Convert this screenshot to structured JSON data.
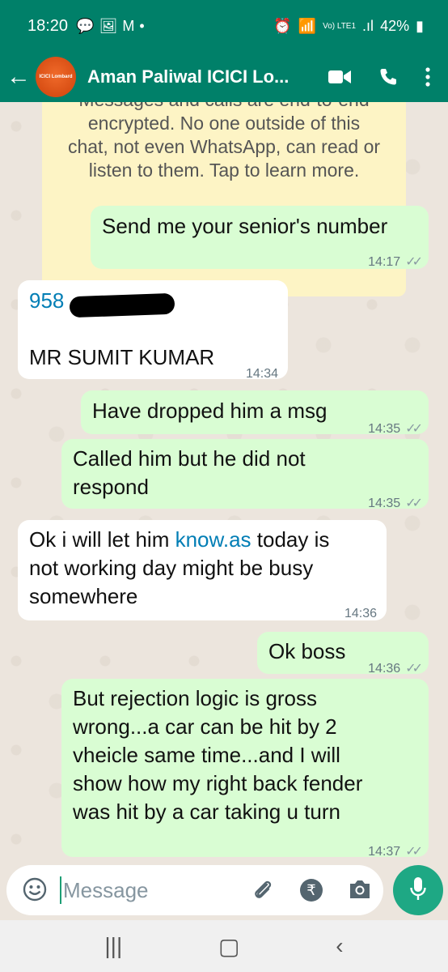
{
  "status_bar": {
    "time": "18:20",
    "battery": "42%",
    "network": "Vo) LTE1"
  },
  "header": {
    "contact_name": "Aman Paliwal ICICI Lo...",
    "avatar_text": "ICICI Lombard"
  },
  "encryption_notice": {
    "lines": [
      "Messages and calls are end-to-end",
      "encrypted. No one outside of this",
      "chat, not even WhatsApp, can read or",
      "listen to them. Tap to learn more."
    ]
  },
  "messages": [
    {
      "direction": "out",
      "text": "Send me your senior's number",
      "time": "14:17"
    },
    {
      "direction": "in",
      "number_prefix": "958",
      "text": "MR SUMIT KUMAR",
      "time": "14:34"
    },
    {
      "direction": "out",
      "text": "Have dropped him a msg",
      "time": "14:35"
    },
    {
      "direction": "out",
      "lines": [
        "Called him but he did not",
        "respond"
      ],
      "time": "14:35"
    },
    {
      "direction": "in",
      "line1_pre": "Ok i will let him ",
      "line1_link": "know.as",
      "line1_post": " today is",
      "lines": [
        "not working day might be busy",
        "somewhere"
      ],
      "time": "14:36"
    },
    {
      "direction": "out",
      "text": "Ok boss",
      "time": "14:36"
    },
    {
      "direction": "out",
      "lines": [
        "But rejection logic is gross",
        "wrong...a car can be hit by 2",
        "vheicle same time...and I will",
        "show how my right back fender",
        "was hit by a car taking u turn"
      ],
      "time": "14:37"
    }
  ],
  "composer": {
    "placeholder": "Message"
  },
  "colors": {
    "header_green": "#008069",
    "outgoing_bubble": "#d9fdd3",
    "incoming_bubble": "#ffffff",
    "link": "#027eb5",
    "mic_button": "#1ea884"
  }
}
